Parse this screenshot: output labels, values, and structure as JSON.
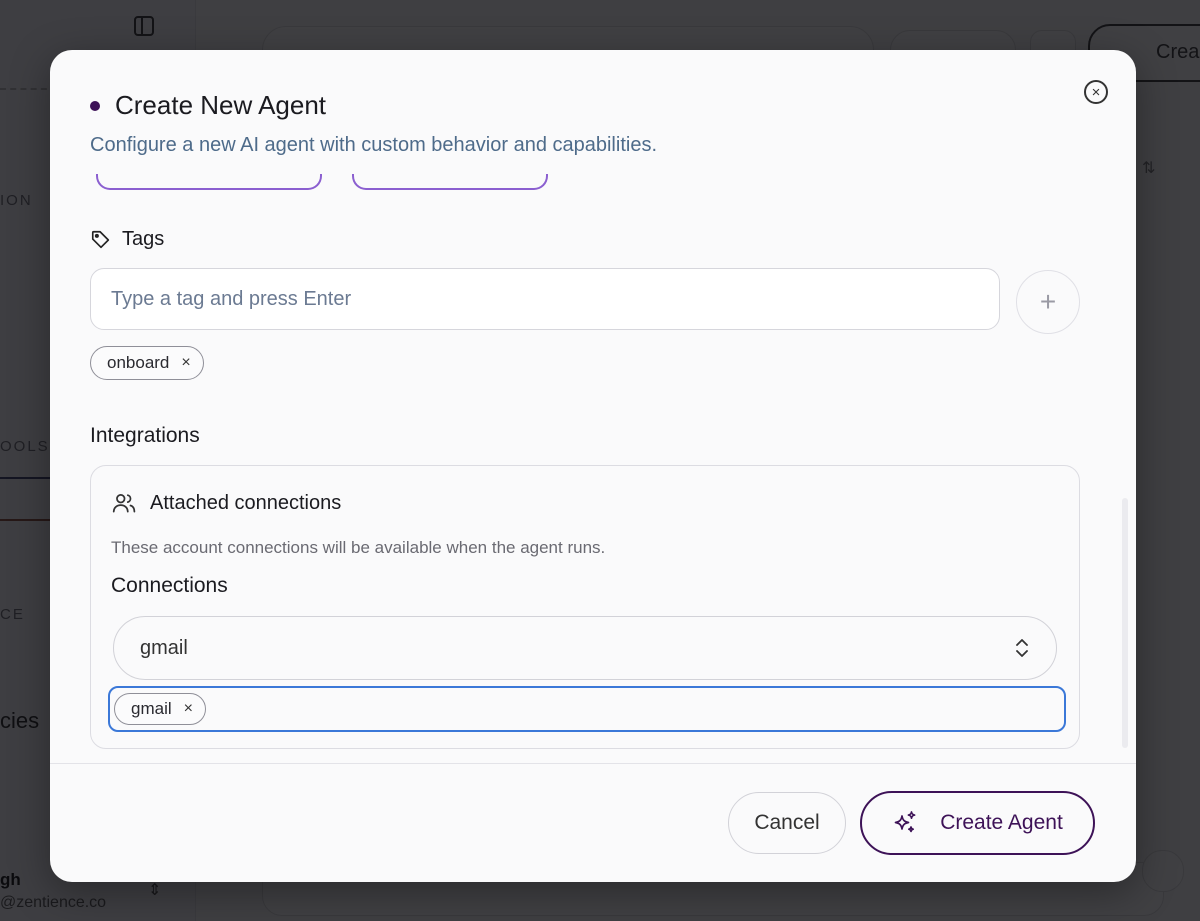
{
  "modal": {
    "title": "Create New Agent",
    "subtitle": "Configure a new AI agent with custom behavior and capabilities.",
    "close_icon": "close-circle-icon"
  },
  "tags": {
    "label": "Tags",
    "icon": "tag-icon",
    "input_placeholder": "Type a tag and press Enter",
    "add_icon": "plus-icon",
    "chips": [
      {
        "label": "onboard",
        "remove_glyph": "×"
      }
    ]
  },
  "integrations": {
    "label": "Integrations",
    "section_icon": "users-icon",
    "section_title": "Attached connections",
    "section_description": "These account connections will be available when the agent runs.",
    "connections_label": "Connections",
    "select_value": "gmail",
    "select_icon": "chevron-up-down-icon",
    "selected_chips": [
      {
        "label": "gmail",
        "remove_glyph": "×"
      }
    ]
  },
  "footer": {
    "cancel_label": "Cancel",
    "create_label": "Create Agent",
    "create_icon": "sparkles-icon"
  },
  "colors": {
    "accent": "#3d1257",
    "focus_ring": "#3b78d8",
    "subtitle": "#4e6b8a"
  }
}
